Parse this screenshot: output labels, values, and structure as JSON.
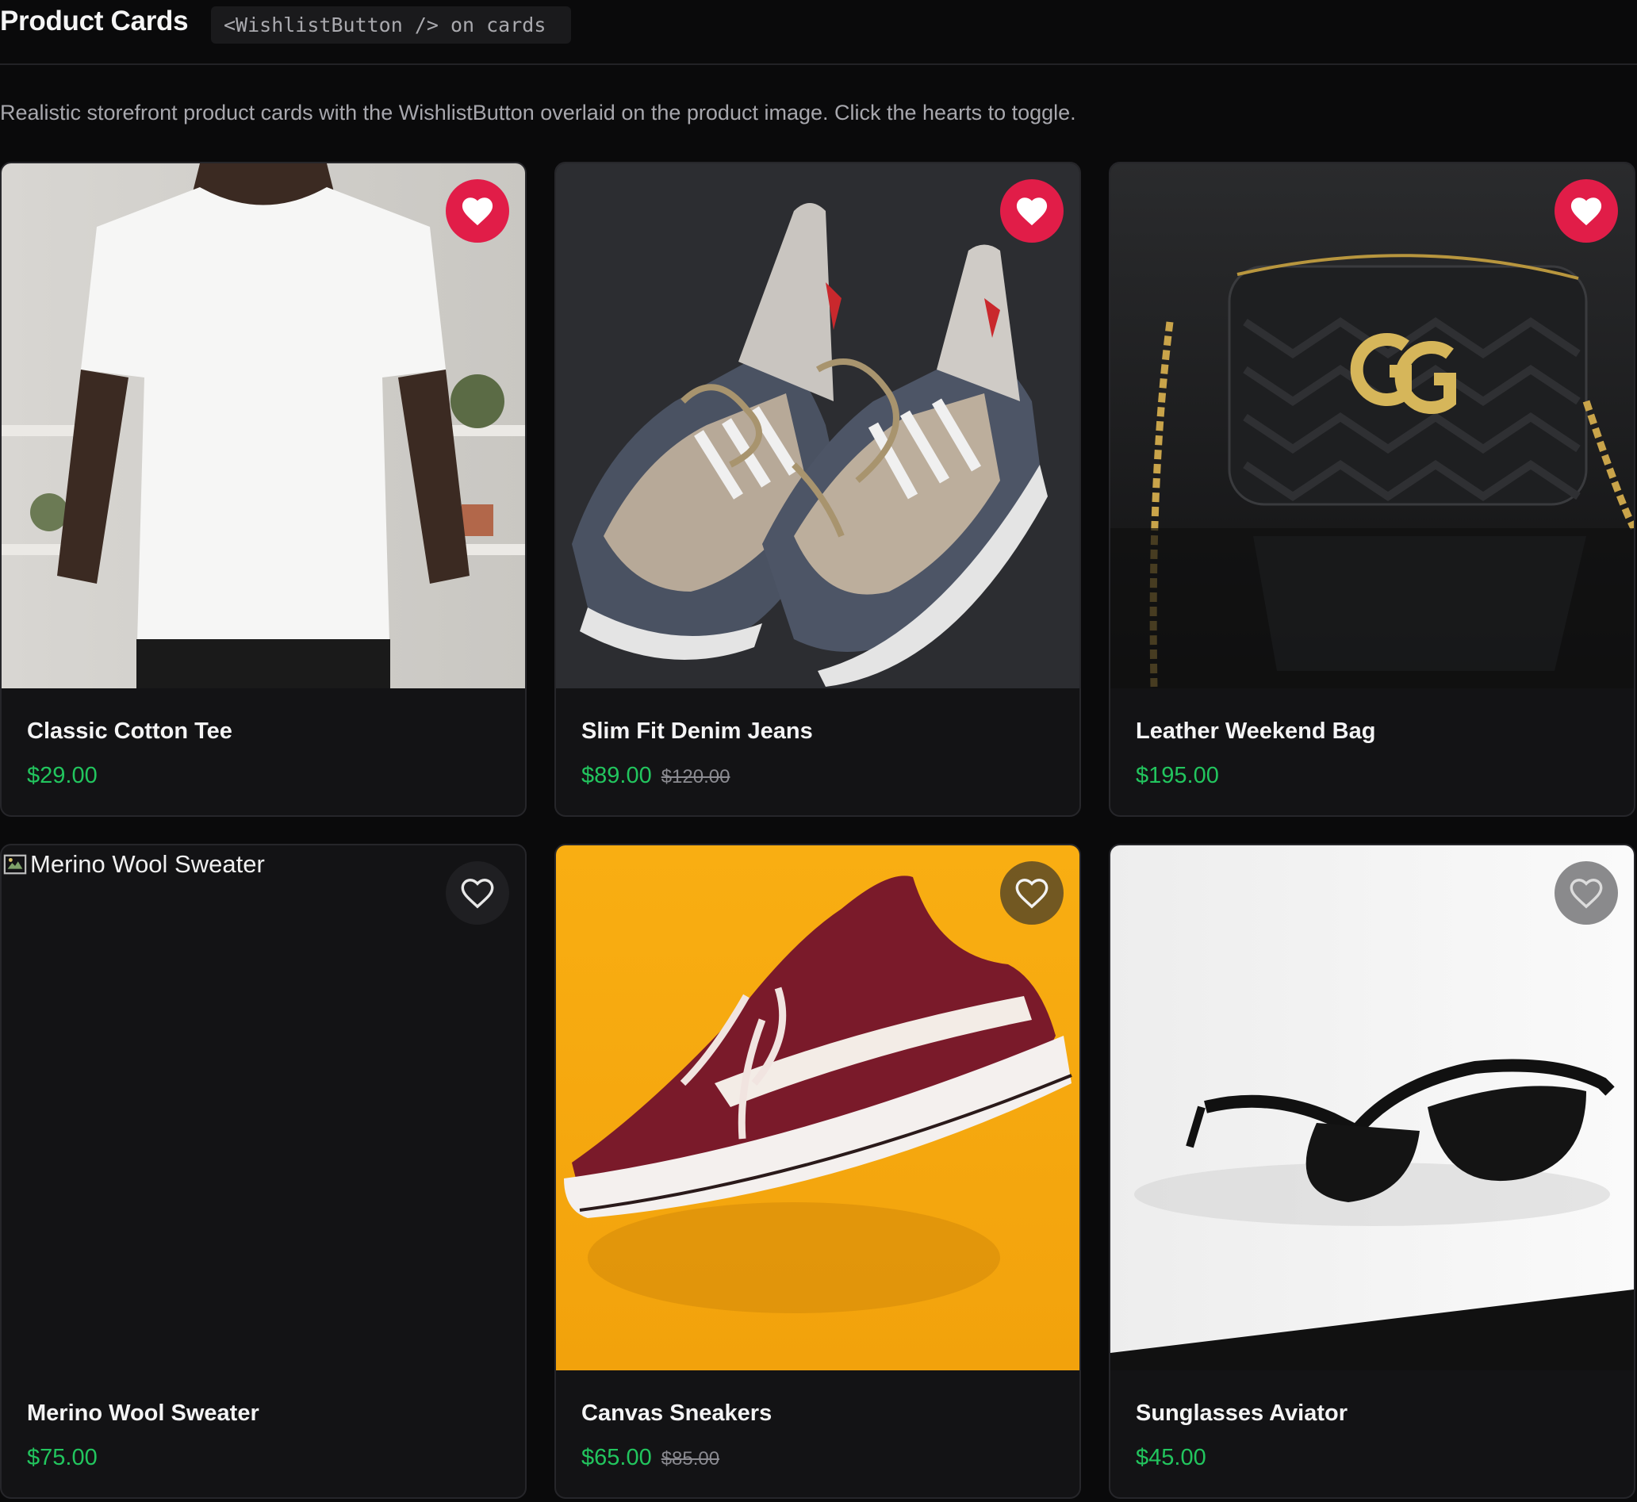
{
  "header": {
    "title": "Product Cards",
    "tag": "<WishlistButton /> on cards"
  },
  "description": "Realistic storefront product cards with the WishlistButton overlaid on the product image. Click the hearts to toggle.",
  "colors": {
    "accent_heart": "#e11d48",
    "price": "#22c55e",
    "background": "#0a0a0b",
    "card": "#131315"
  },
  "products": [
    {
      "name": "Classic Cotton Tee",
      "price": "$29.00",
      "was": "",
      "wishlisted": true,
      "image": "white-tshirt-photo"
    },
    {
      "name": "Slim Fit Denim Jeans",
      "price": "$89.00",
      "was": "$120.00",
      "wishlisted": true,
      "image": "sneakers-photo"
    },
    {
      "name": "Leather Weekend Bag",
      "price": "$195.00",
      "was": "",
      "wishlisted": true,
      "image": "quilted-bag-photo"
    },
    {
      "name": "Merino Wool Sweater",
      "price": "$75.00",
      "was": "",
      "wishlisted": false,
      "image": "broken-image",
      "alt": "Merino Wool Sweater"
    },
    {
      "name": "Canvas Sneakers",
      "price": "$65.00",
      "was": "$85.00",
      "wishlisted": false,
      "image": "canvas-sneaker-photo"
    },
    {
      "name": "Sunglasses Aviator",
      "price": "$45.00",
      "was": "",
      "wishlisted": false,
      "image": "sunglasses-photo"
    }
  ]
}
